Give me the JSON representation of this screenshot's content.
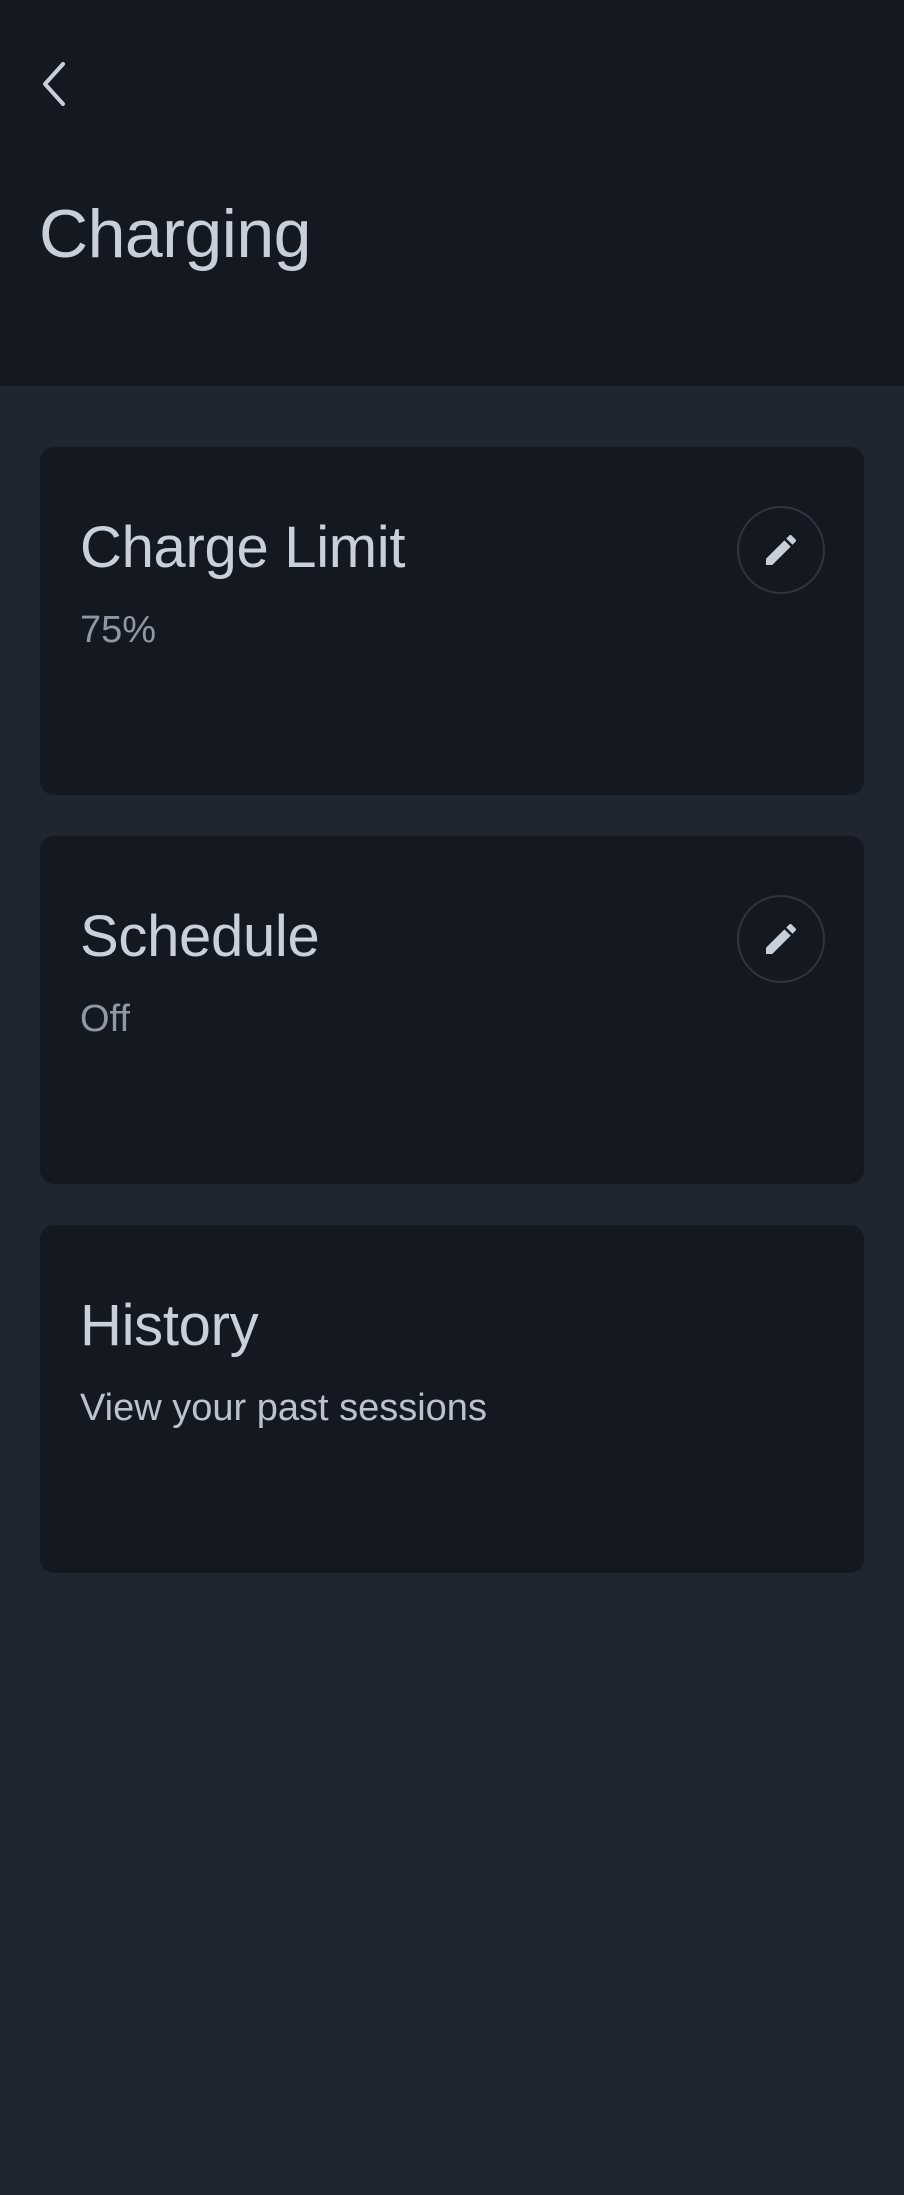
{
  "header": {
    "back_icon": "chevron-left-icon",
    "title": "Charging"
  },
  "cards": [
    {
      "title": "Charge Limit",
      "subtitle": "75%",
      "action_icon": "pencil-icon"
    },
    {
      "title": "Schedule",
      "subtitle": "Off",
      "action_icon": "pencil-icon"
    },
    {
      "title": "History",
      "subtitle": "View your past sessions"
    }
  ],
  "colors": {
    "header_bg": "#141820",
    "page_bg": "#1f262f",
    "card_bg": "#141820",
    "text_primary": "#c8d0dc",
    "text_secondary": "#8f98a5"
  }
}
